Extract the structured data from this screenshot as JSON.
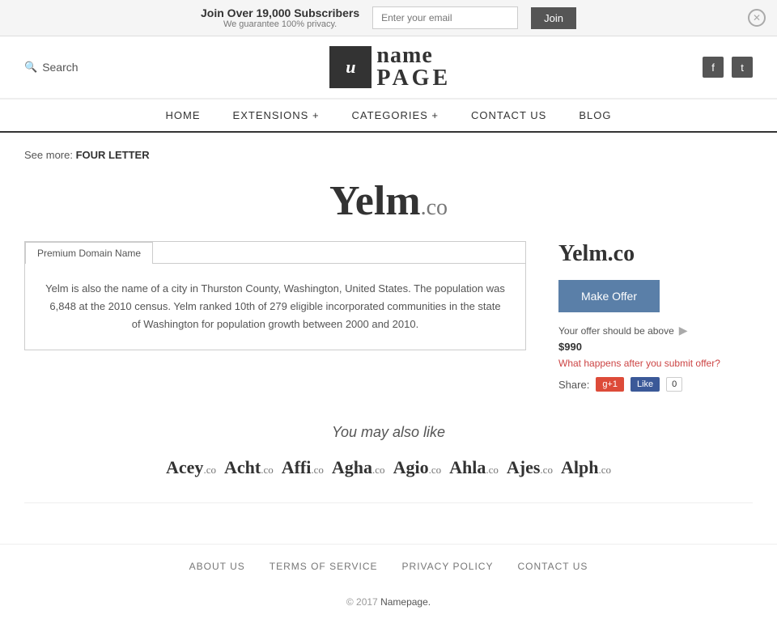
{
  "banner": {
    "title": "Join Over 19,000 Subscribers",
    "subtitle": "We guarantee 100% privacy.",
    "email_placeholder": "Enter your email",
    "join_label": "Join"
  },
  "header": {
    "search_label": "Search",
    "logo_icon": "u",
    "logo_name": "name",
    "logo_page": "PAGE",
    "facebook_url": "#",
    "twitter_url": "#"
  },
  "nav": {
    "items": [
      {
        "label": "HOME"
      },
      {
        "label": "EXTENSIONS +"
      },
      {
        "label": "CATEGORIES +"
      },
      {
        "label": "CONTACT  US"
      },
      {
        "label": "BLOG"
      }
    ]
  },
  "breadcrumb": {
    "see_more_label": "See more:",
    "category": "FOUR LETTER"
  },
  "domain": {
    "name": "Yelm",
    "tld": ".co",
    "full": "Yelm.co",
    "premium_tab_label": "Premium Domain Name",
    "description": "Yelm is also the name of a city in Thurston County, Washington, United States. The population was 6,848 at the 2010 census. Yelm ranked 10th of 279 eligible incorporated communities in the state of Washington for population growth between 2000 and 2010.",
    "make_offer_label": "Make Offer",
    "offer_note": "Your offer should be above",
    "offer_price": "$990",
    "what_happens_label": "What happens after you submit offer?",
    "share_label": "Share:",
    "gplus_label": "g+1",
    "fb_like_label": "Like",
    "fb_count": "0"
  },
  "also_like": {
    "title": "You may also like",
    "items": [
      {
        "name": "Acey",
        "tld": ".co"
      },
      {
        "name": "Acht",
        "tld": ".co"
      },
      {
        "name": "Affi",
        "tld": ".co"
      },
      {
        "name": "Agha",
        "tld": ".co"
      },
      {
        "name": "Agio",
        "tld": ".co"
      },
      {
        "name": "Ahla",
        "tld": ".co"
      },
      {
        "name": "Ajes",
        "tld": ".co"
      },
      {
        "name": "Alph",
        "tld": ".co"
      }
    ]
  },
  "footer": {
    "links": [
      {
        "label": "ABOUT US"
      },
      {
        "label": "TERMS OF SERVICE"
      },
      {
        "label": "PRIVACY POLICY"
      },
      {
        "label": "CONTACT US"
      }
    ],
    "copyright": "© 2017",
    "brand": "Namepage."
  }
}
